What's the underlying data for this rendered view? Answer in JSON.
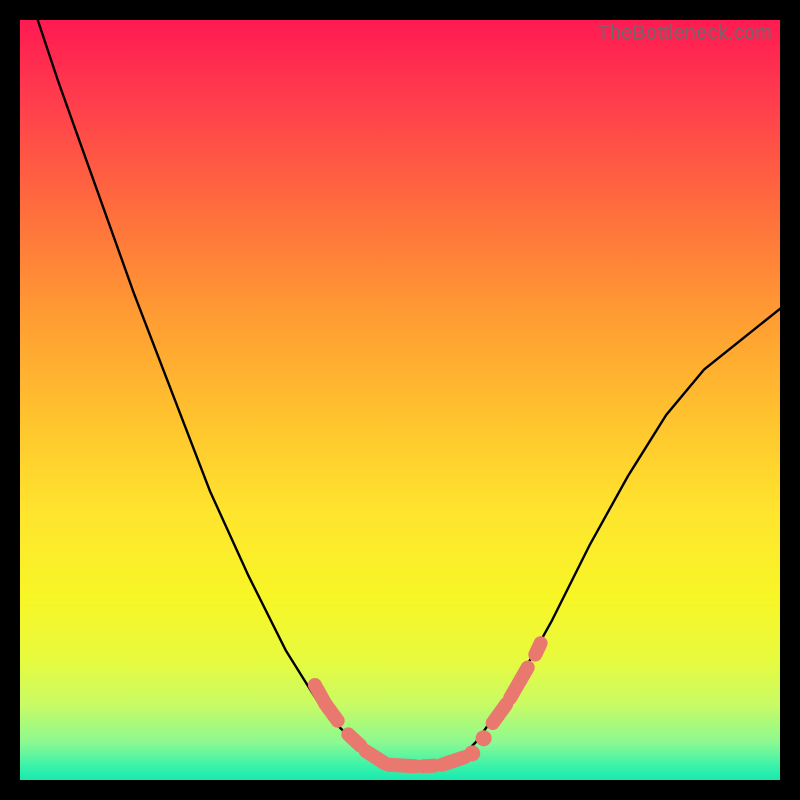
{
  "watermark": "TheBottleneck.com",
  "colors": {
    "frame": "#000000",
    "curve": "#000000",
    "marker": "#e9786f",
    "gradient_stops": [
      "#ff1a52",
      "#ff3b4d",
      "#ff6a3e",
      "#ff9933",
      "#ffc22e",
      "#ffe52e",
      "#f7f626",
      "#e8fa3e",
      "#c9fb63",
      "#8df991",
      "#3ef3a8",
      "#18e9b0"
    ]
  },
  "chart_data": {
    "type": "line",
    "title": "",
    "xlabel": "",
    "ylabel": "",
    "x": [
      0.0,
      0.05,
      0.1,
      0.15,
      0.2,
      0.25,
      0.3,
      0.35,
      0.4,
      0.45,
      0.48,
      0.5,
      0.55,
      0.58,
      0.6,
      0.65,
      0.7,
      0.75,
      0.8,
      0.85,
      0.9,
      0.95,
      1.0
    ],
    "values": [
      1.07,
      0.92,
      0.78,
      0.64,
      0.51,
      0.38,
      0.27,
      0.17,
      0.09,
      0.04,
      0.02,
      0.02,
      0.02,
      0.03,
      0.05,
      0.12,
      0.21,
      0.31,
      0.4,
      0.48,
      0.54,
      0.58,
      0.62
    ],
    "xlim": [
      0,
      1
    ],
    "ylim": [
      0,
      1
    ],
    "markers": {
      "left_segments": [
        {
          "x0": 0.388,
          "y0": 0.125,
          "x1": 0.402,
          "y1": 0.1
        },
        {
          "x0": 0.402,
          "y0": 0.1,
          "x1": 0.418,
          "y1": 0.078
        },
        {
          "x0": 0.432,
          "y0": 0.06,
          "x1": 0.448,
          "y1": 0.045
        },
        {
          "x0": 0.455,
          "y0": 0.038,
          "x1": 0.48,
          "y1": 0.022
        }
      ],
      "bottom_segments": [
        {
          "x0": 0.485,
          "y0": 0.02,
          "x1": 0.52,
          "y1": 0.018
        },
        {
          "x0": 0.53,
          "y0": 0.018,
          "x1": 0.545,
          "y1": 0.019
        },
        {
          "x0": 0.555,
          "y0": 0.02,
          "x1": 0.585,
          "y1": 0.03
        }
      ],
      "right_segments": [
        {
          "x0": 0.622,
          "y0": 0.075,
          "x1": 0.64,
          "y1": 0.1
        },
        {
          "x0": 0.645,
          "y0": 0.108,
          "x1": 0.668,
          "y1": 0.148
        },
        {
          "x0": 0.678,
          "y0": 0.165,
          "x1": 0.685,
          "y1": 0.18
        }
      ],
      "bottom_dots": [
        {
          "x": 0.595,
          "y": 0.035
        },
        {
          "x": 0.61,
          "y": 0.055
        }
      ]
    }
  }
}
